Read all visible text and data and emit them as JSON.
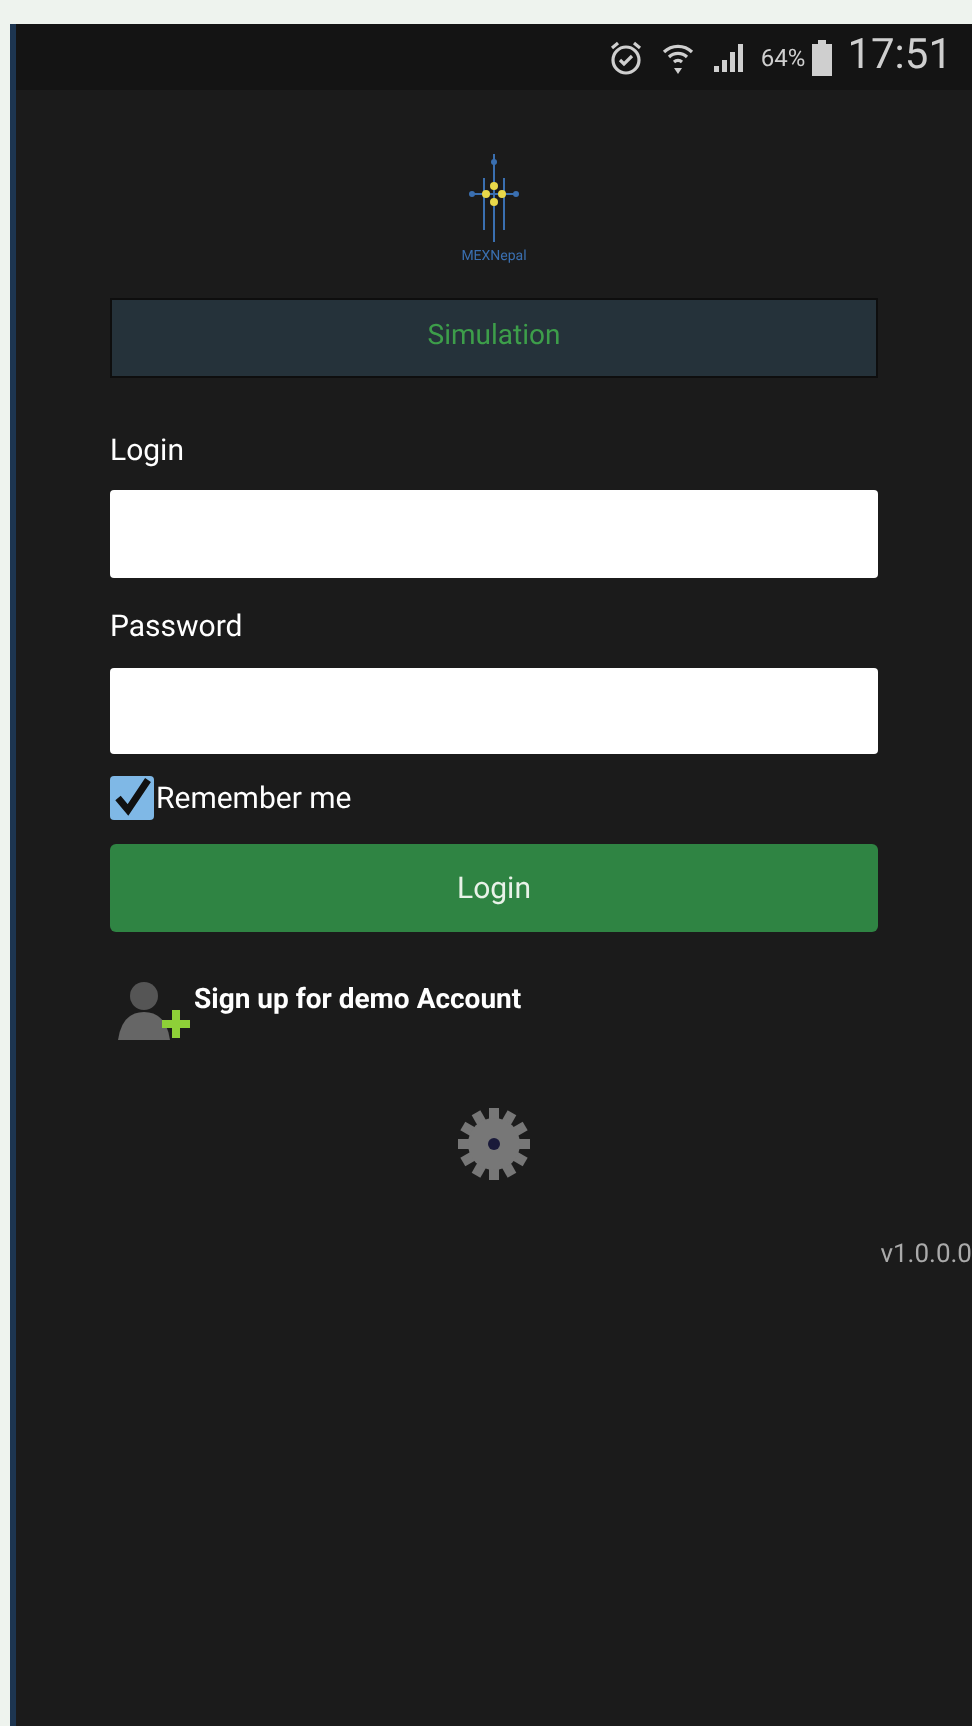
{
  "status_bar": {
    "battery": "64%",
    "time": "17:51"
  },
  "logo": {
    "text": "MEXNepal"
  },
  "mode_bar": {
    "label": "Simulation"
  },
  "form": {
    "login_label": "Login",
    "password_label": "Password",
    "remember": {
      "label": "Remember me",
      "checked": true
    },
    "submit": "Login"
  },
  "signup": {
    "label": "Sign up for demo Account"
  },
  "version": "v1.0.0.0"
}
